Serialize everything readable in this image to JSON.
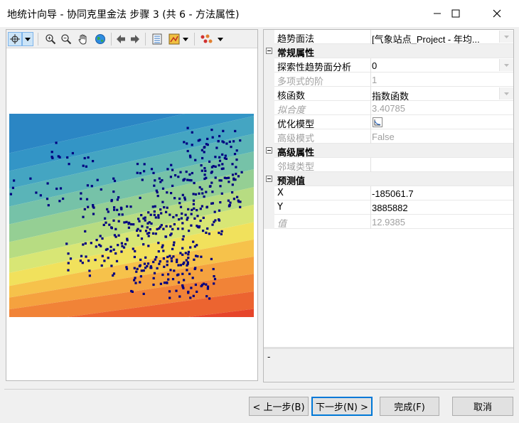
{
  "window": {
    "title": "地统计向导 - 协同克里金法 步骤 3 (共 6 - 方法属性)"
  },
  "toolbar": {
    "icons": [
      "select-tool-icon",
      "dropdown-arrow-icon",
      "zoom-in-icon",
      "zoom-out-icon",
      "pan-hand-icon",
      "full-extent-globe-icon",
      "back-arrow-icon",
      "forward-arrow-icon",
      "layer-list-icon",
      "symbology-icon",
      "dropdown-arrow-icon",
      "points-display-icon",
      "dropdown-arrow-icon"
    ]
  },
  "properties": {
    "rows": [
      {
        "name": "趋势面法",
        "value": "[气象站点_Project - 年均...",
        "type": "prop",
        "dropdown": true
      },
      {
        "name": "常规属性",
        "type": "category"
      },
      {
        "name": "探索性趋势面分析",
        "value": "0",
        "type": "prop",
        "dropdown": true
      },
      {
        "name": "多项式的阶",
        "value": "1",
        "type": "prop",
        "disabled": true
      },
      {
        "name": "核函数",
        "value": "指数函数",
        "type": "prop",
        "dropdown": true
      },
      {
        "name": "拟合度",
        "value": "3.40785",
        "type": "prop",
        "disabled": true,
        "italic": true
      },
      {
        "name": "优化模型",
        "value": "",
        "type": "prop",
        "button": true
      },
      {
        "name": "高级模式",
        "value": "False",
        "type": "prop",
        "disabled": true
      },
      {
        "name": "高级属性",
        "type": "category"
      },
      {
        "name": "邻域类型",
        "value": "",
        "type": "prop",
        "disabled": true
      },
      {
        "name": "预测值",
        "type": "category"
      },
      {
        "name": "X",
        "value": "-185061.7",
        "type": "prop"
      },
      {
        "name": "Y",
        "value": "3885882",
        "type": "prop"
      },
      {
        "name": "值",
        "value": "12.9385",
        "type": "prop",
        "disabled": true,
        "italic": true
      }
    ],
    "description": "-"
  },
  "buttons": {
    "back": "< 上一步(B)",
    "next": "下一步(N) >",
    "finish": "完成(F)",
    "cancel": "取消"
  },
  "colors": {
    "selection": "#cce4f7",
    "primary_border": "#0078d7",
    "points": "#000080"
  }
}
